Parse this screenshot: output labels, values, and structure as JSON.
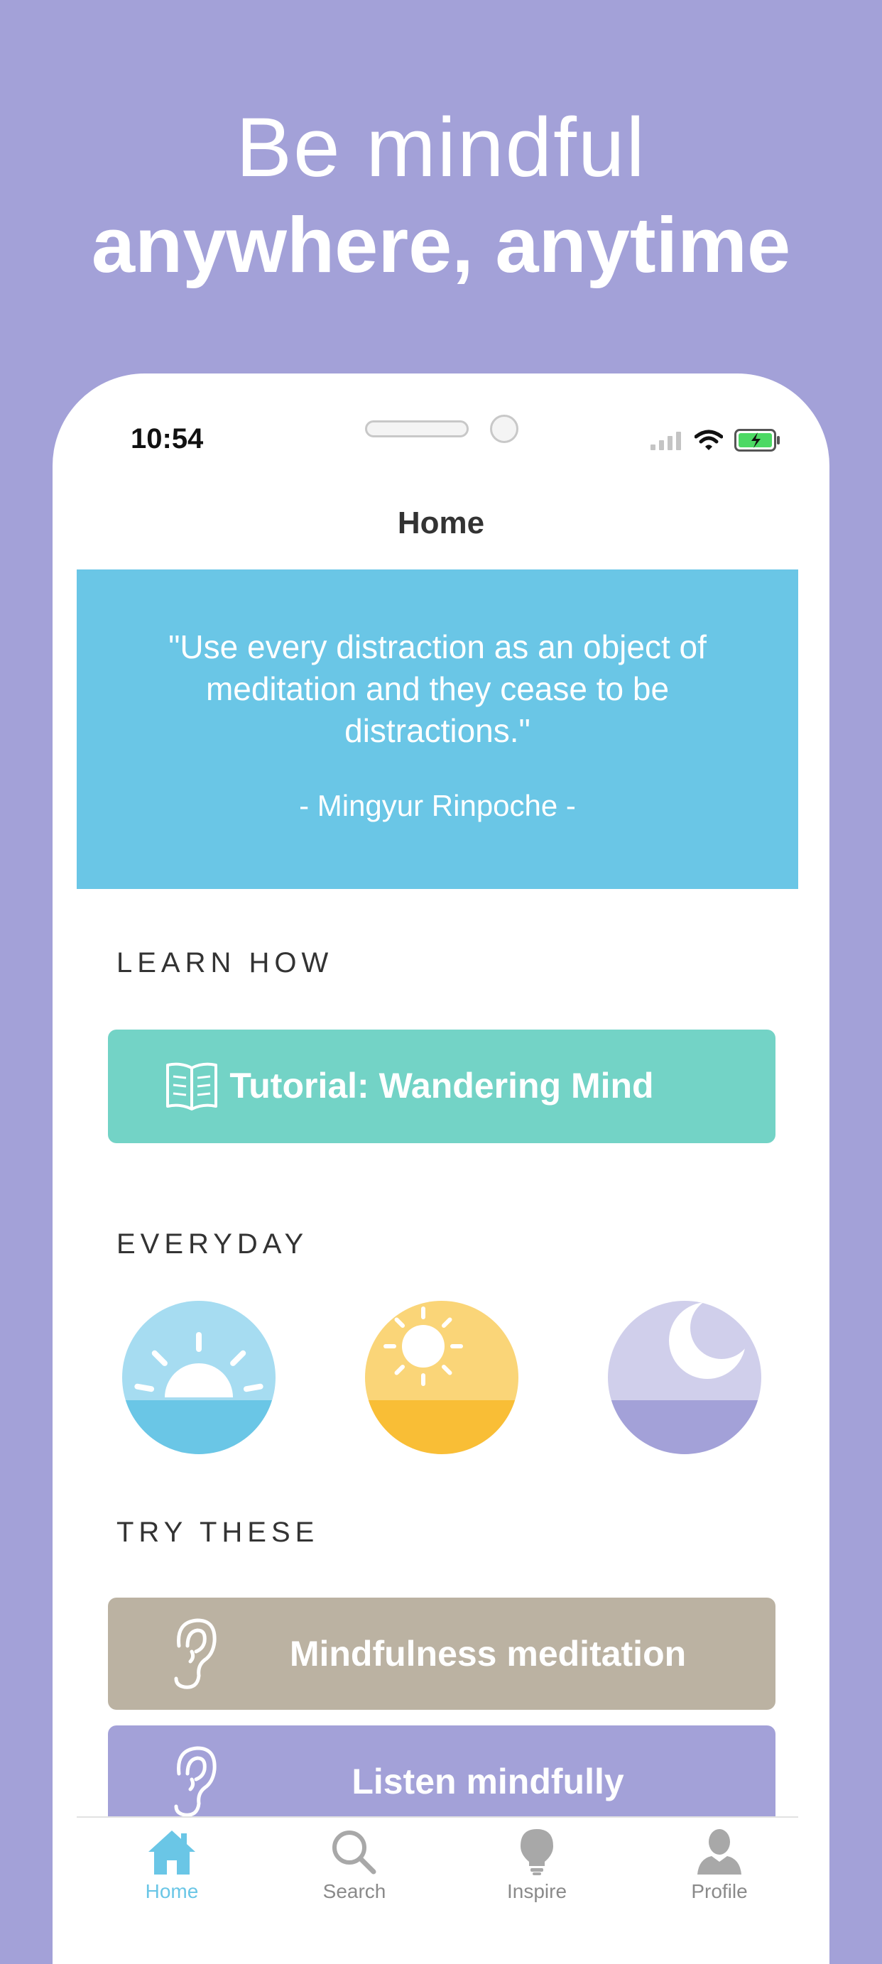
{
  "headline": {
    "line1": "Be mindful",
    "line2": "anywhere, anytime"
  },
  "status_bar": {
    "time": "10:54"
  },
  "nav": {
    "title": "Home"
  },
  "quote": {
    "text": "\"Use every distraction as an object of meditation and they cease to be distractions.\"",
    "author": "- Mingyur Rinpoche -"
  },
  "sections": {
    "learn_how": "LEARN HOW",
    "everyday": "EVERYDAY",
    "try_these": "TRY THESE"
  },
  "tutorial": {
    "label": "Tutorial: Wandering Mind",
    "icon": "book-icon"
  },
  "everyday_icons": [
    "sunrise-icon",
    "sun-icon",
    "moon-icon"
  ],
  "try_these": [
    {
      "label": "Mindfulness meditation",
      "icon": "ear-icon",
      "color": "#bbb2a2"
    },
    {
      "label": "Listen mindfully",
      "icon": "ear-icon",
      "color": "#a3a1d8"
    }
  ],
  "tabs": [
    {
      "label": "Home",
      "icon": "home-icon",
      "active": true
    },
    {
      "label": "Search",
      "icon": "search-icon",
      "active": false
    },
    {
      "label": "Inspire",
      "icon": "lightbulb-icon",
      "active": false
    },
    {
      "label": "Profile",
      "icon": "profile-icon",
      "active": false
    }
  ],
  "colors": {
    "background": "#a3a1d8",
    "quote_card": "#6ac6e6",
    "tutorial": "#73d3c6",
    "accent": "#6ac6e6",
    "tab_inactive": "#a8a8a8"
  }
}
